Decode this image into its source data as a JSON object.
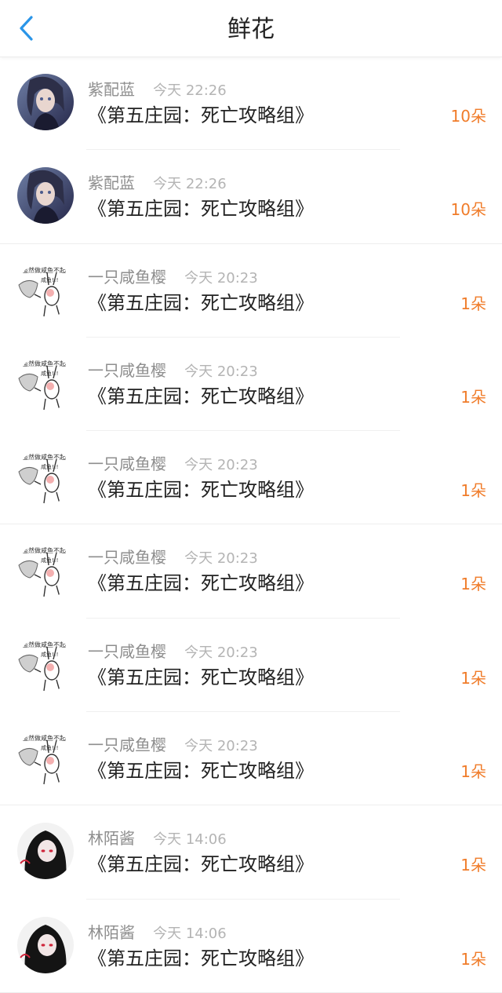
{
  "header": {
    "title": "鲜花",
    "back_icon": "chevron-left-icon",
    "accent_color": "#2a95e8"
  },
  "count_color": "#f07c2a",
  "rows": [
    {
      "user": "紫配蓝",
      "time": "今天 22:26",
      "title": "《第五庄园：死亡攻略组》",
      "count": "10朵",
      "avatar": "anime-portrait-dark"
    },
    {
      "user": "紫配蓝",
      "time": "今天 22:26",
      "title": "《第五庄园：死亡攻略组》",
      "count": "10朵",
      "avatar": "anime-portrait-dark"
    },
    {
      "user": "一只咸鱼樱",
      "time": "今天 20:23",
      "title": "《第五庄园：死亡攻略组》",
      "count": "1朵",
      "avatar": "meme-sticker",
      "avatar_text": "虽然做咸鱼不起",
      "avatar_text2": "咸鱼!!!"
    },
    {
      "user": "一只咸鱼樱",
      "time": "今天 20:23",
      "title": "《第五庄园：死亡攻略组》",
      "count": "1朵",
      "avatar": "meme-sticker",
      "avatar_text": "虽然做咸鱼不起",
      "avatar_text2": "咸鱼!!!"
    },
    {
      "user": "一只咸鱼樱",
      "time": "今天 20:23",
      "title": "《第五庄园：死亡攻略组》",
      "count": "1朵",
      "avatar": "meme-sticker",
      "avatar_text": "虽然做咸鱼不起",
      "avatar_text2": "咸鱼!!!"
    },
    {
      "user": "一只咸鱼樱",
      "time": "今天 20:23",
      "title": "《第五庄园：死亡攻略组》",
      "count": "1朵",
      "avatar": "meme-sticker",
      "avatar_text": "虽然做咸鱼不起",
      "avatar_text2": "咸鱼!!!"
    },
    {
      "user": "一只咸鱼樱",
      "time": "今天 20:23",
      "title": "《第五庄园：死亡攻略组》",
      "count": "1朵",
      "avatar": "meme-sticker",
      "avatar_text": "虽然做咸鱼不起",
      "avatar_text2": "咸鱼!!!"
    },
    {
      "user": "一只咸鱼樱",
      "time": "今天 20:23",
      "title": "《第五庄园：死亡攻略组》",
      "count": "1朵",
      "avatar": "meme-sticker",
      "avatar_text": "虽然做咸鱼不起",
      "avatar_text2": "咸鱼!!!"
    },
    {
      "user": "林陌酱",
      "time": "今天 14:06",
      "title": "《第五庄园：死亡攻略组》",
      "count": "1朵",
      "avatar": "anime-girl-black-hair"
    },
    {
      "user": "林陌酱",
      "time": "今天 14:06",
      "title": "《第五庄园：死亡攻略组》",
      "count": "1朵",
      "avatar": "anime-girl-black-hair"
    }
  ]
}
